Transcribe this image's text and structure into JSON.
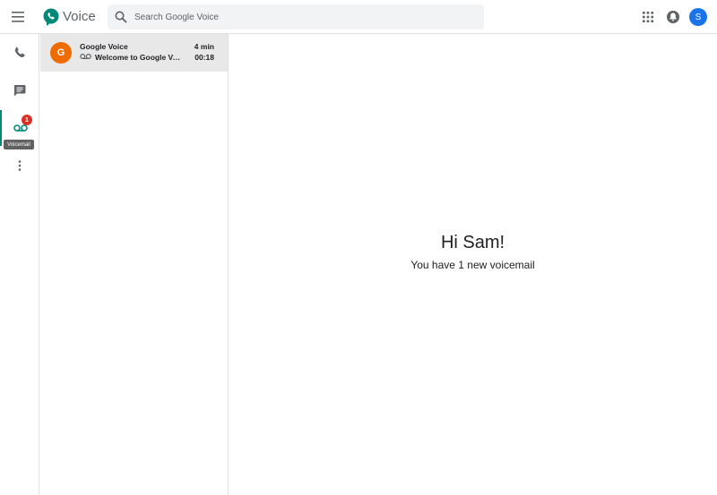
{
  "header": {
    "app_title": "Voice",
    "search_placeholder": "Search Google Voice",
    "avatar_initial": "S",
    "icons": [
      "menu-icon",
      "voice-logo-icon",
      "search-icon",
      "apps-grid-icon",
      "notifications-icon"
    ]
  },
  "rail": {
    "items": [
      {
        "name": "calls",
        "icon": "phone-icon"
      },
      {
        "name": "messages",
        "icon": "message-icon"
      },
      {
        "name": "voicemail",
        "icon": "voicemail-icon",
        "badge": "1",
        "active": true
      },
      {
        "name": "more",
        "icon": "more-vert-icon"
      }
    ],
    "tooltip": "Voicemail"
  },
  "list": {
    "items": [
      {
        "avatar_initial": "G",
        "name": "Google Voice",
        "time": "4 min",
        "message": "Welcome to Google Voice",
        "duration": "00:18"
      }
    ]
  },
  "main": {
    "greeting": "Hi Sam!",
    "subtext": "You have 1 new voicemail"
  },
  "colors": {
    "accent": "#00897b",
    "badge": "#d93025",
    "avatar_user": "#1a73e8",
    "avatar_contact": "#ef6c00",
    "selected_row": "#e8e8e8"
  }
}
